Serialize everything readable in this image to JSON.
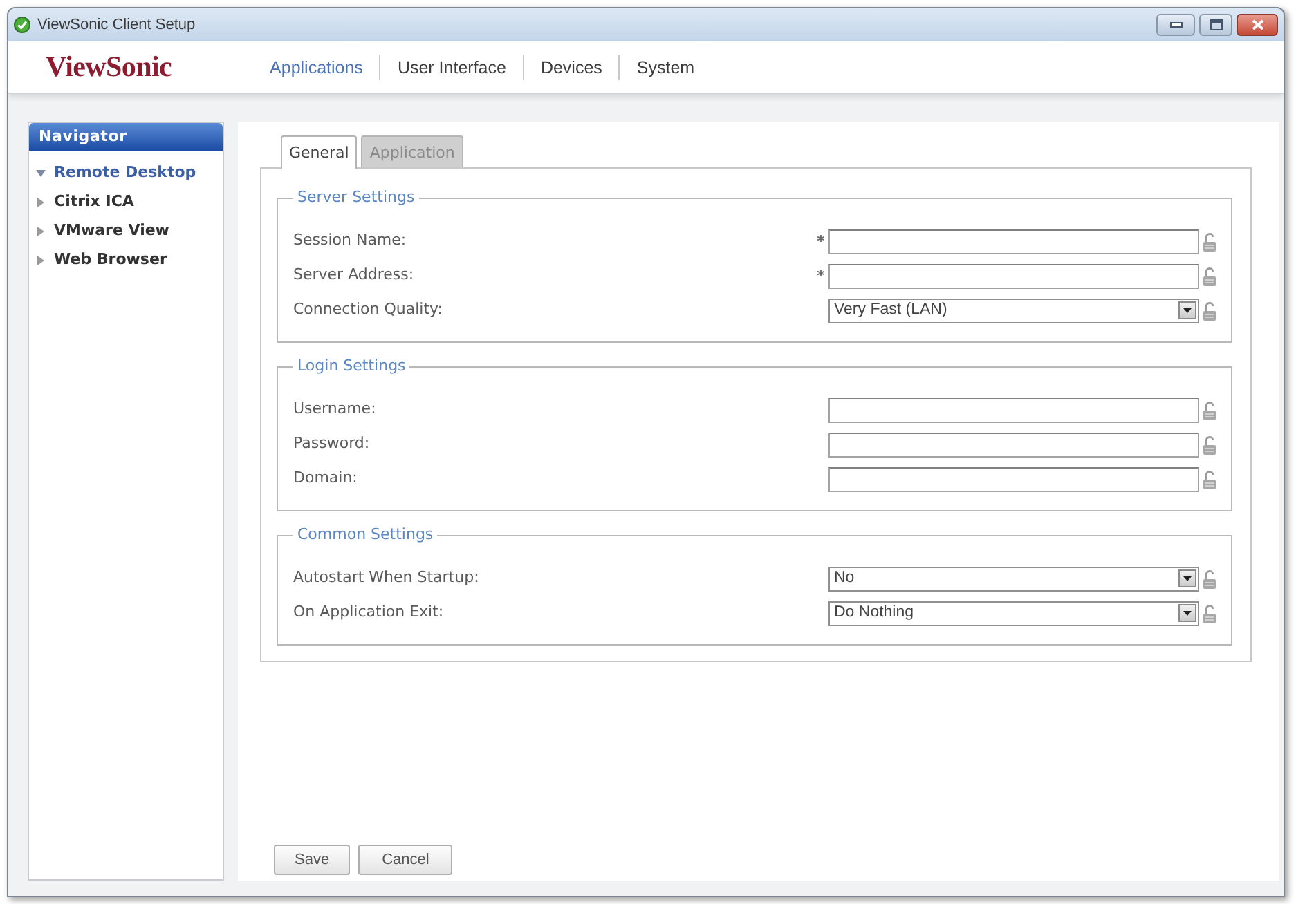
{
  "window": {
    "title": "ViewSonic Client Setup"
  },
  "header": {
    "logo": "ViewSonic",
    "menu": [
      {
        "label": "Applications",
        "selected": true
      },
      {
        "label": "User Interface",
        "selected": false
      },
      {
        "label": "Devices",
        "selected": false
      },
      {
        "label": "System",
        "selected": false
      }
    ]
  },
  "navigator": {
    "title": "Navigator",
    "items": [
      {
        "label": "Remote Desktop",
        "selected": true,
        "expanded": true
      },
      {
        "label": "Citrix ICA",
        "selected": false,
        "expanded": false
      },
      {
        "label": "VMware View",
        "selected": false,
        "expanded": false
      },
      {
        "label": "Web Browser",
        "selected": false,
        "expanded": false
      }
    ]
  },
  "tabs": [
    {
      "label": "General",
      "selected": true
    },
    {
      "label": "Application",
      "selected": false
    }
  ],
  "sections": [
    {
      "title": "Server Settings",
      "fields": [
        {
          "kind": "text",
          "label": "Session Name:",
          "required": true
        },
        {
          "kind": "text",
          "label": "Server Address:",
          "required": true
        },
        {
          "kind": "select",
          "label": "Connection Quality:",
          "required": false,
          "value": "Very Fast (LAN)"
        }
      ]
    },
    {
      "title": "Login Settings",
      "fields": [
        {
          "kind": "text",
          "label": "Username:",
          "required": false
        },
        {
          "kind": "text",
          "label": "Password:",
          "required": false
        },
        {
          "kind": "text",
          "label": "Domain:",
          "required": false
        }
      ]
    },
    {
      "title": "Common Settings",
      "fields": [
        {
          "kind": "select",
          "label": "Autostart When Startup:",
          "required": false,
          "value": "No"
        },
        {
          "kind": "select",
          "label": "On Application Exit:",
          "required": false,
          "value": "Do Nothing"
        }
      ]
    }
  ],
  "buttons": [
    {
      "label": "Save"
    },
    {
      "label": "Cancel"
    }
  ]
}
